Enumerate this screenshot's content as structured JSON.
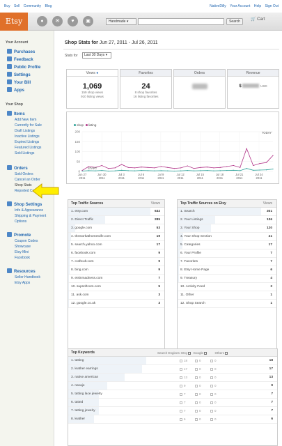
{
  "top": {
    "left_links": [
      "Buy",
      "Sell",
      "Community",
      "Blog"
    ],
    "right_links": [
      "NativeDilly",
      "Your Account",
      "Help",
      "Sign Out"
    ]
  },
  "nav": {
    "logo": "Etsy",
    "icons": [
      "circle-icon",
      "mail-icon",
      "heart-icon",
      "bag-icon"
    ],
    "search_category": "Handmade",
    "search_placeholder": "",
    "search_button": "Search",
    "cart_label": "Cart"
  },
  "sidebar": {
    "account_heading": "Your Account",
    "account_items": [
      "Purchases",
      "Feedback",
      "Public Profile",
      "Settings",
      "Your Bill",
      "Apps"
    ],
    "shop_heading": "Your Shop",
    "items_title": "Items",
    "items_sub": [
      "Add New Item",
      "Currently for Sale",
      "Draft Listings",
      "Inactive Listings",
      "Expired Listings",
      "Featured Listings",
      "Sold Listings"
    ],
    "orders_title": "Orders",
    "orders_sub": [
      "Sold Orders",
      "Cancel an Order",
      "Shop Stats",
      "Reported Cases"
    ],
    "settings_title": "Shop Settings",
    "settings_sub": [
      "Info & Appearance",
      "Shipping & Payment",
      "Options"
    ],
    "promote_title": "Promote",
    "promote_sub": [
      "Coupon Codes",
      "Showcase",
      "Etsy Mini",
      "Facebook"
    ],
    "resources_title": "Resources",
    "resources_sub": [
      "Seller Handbook",
      "Etsy Apps"
    ]
  },
  "main": {
    "title_prefix": "Shop Stats for",
    "title_range": "Jun 27, 2011 - Jul 26, 2011",
    "stats_for_label": "Stats for",
    "range_value": "Last 30 Days",
    "cards": {
      "views": {
        "label": "Views",
        "value": "1,069",
        "line1": "159 shop views",
        "line2": "910 listing views"
      },
      "favorites": {
        "label": "Favorites",
        "value": "24",
        "line1": "8 shop favorites",
        "line2": "16 listing favorites"
      },
      "orders": {
        "label": "Orders"
      },
      "revenue": {
        "label": "Revenue",
        "prefix": "$",
        "suffix": "USD"
      }
    }
  },
  "chart_data": {
    "type": "line",
    "legend": [
      "shop",
      "listing"
    ],
    "y_ticks": [
      "0",
      "50",
      "100",
      "150",
      "200"
    ],
    "ylim": [
      0,
      200
    ],
    "x_tick_labels": [
      [
        "Jun 27",
        "2011"
      ],
      [
        "Jun 30",
        "2011"
      ],
      [
        "Jul 3",
        "2011"
      ],
      [
        "Jul 6",
        "2011"
      ],
      [
        "Jul 9",
        "2011"
      ],
      [
        "Jul 12",
        "2011"
      ],
      [
        "Jul 15",
        "2011"
      ],
      [
        "Jul 18",
        "2011"
      ],
      [
        "Jul 21",
        "2011"
      ],
      [
        "Jul 24",
        "2011"
      ]
    ],
    "annotations": [
      "TODAY",
      "START"
    ],
    "series": [
      {
        "name": "listing",
        "color": "#b3378a",
        "values": [
          5,
          25,
          20,
          30,
          15,
          18,
          35,
          20,
          18,
          22,
          20,
          18,
          25,
          20,
          15,
          18,
          28,
          15,
          20,
          22,
          18,
          20,
          25,
          30,
          20,
          115,
          30,
          40,
          45,
          80
        ]
      },
      {
        "name": "shop",
        "color": "#2aa198",
        "values": [
          2,
          4,
          3,
          5,
          2,
          3,
          6,
          4,
          3,
          5,
          4,
          3,
          4,
          3,
          2,
          3,
          5,
          3,
          4,
          5,
          3,
          4,
          5,
          6,
          4,
          15,
          6,
          7,
          8,
          12
        ]
      }
    ]
  },
  "traffic": {
    "title": "Top Traffic Sources",
    "col": "Views",
    "rows": [
      {
        "name": "1. etsy.com",
        "value": "632"
      },
      {
        "name": "2. Direct Traffic",
        "value": "285"
      },
      {
        "name": "3. google.com",
        "value": "53"
      },
      {
        "name": "4. theworkathomewife.com",
        "value": "19"
      },
      {
        "name": "5. search.yahoo.com",
        "value": "17"
      },
      {
        "name": "6. facebook.com",
        "value": "9"
      },
      {
        "name": "7. craftcult.com",
        "value": "9"
      },
      {
        "name": "8. bing.com",
        "value": "9"
      },
      {
        "name": "9. etsinmadness.com",
        "value": "7"
      },
      {
        "name": "10. supsoftcom.com",
        "value": "5"
      },
      {
        "name": "11. ask.com",
        "value": "3"
      },
      {
        "name": "12. google.co.uk",
        "value": "3"
      }
    ]
  },
  "etsy_traffic": {
    "title": "Top Traffic Sources on Etsy",
    "col": "Views",
    "rows": [
      {
        "name": "1. Search",
        "value": "301"
      },
      {
        "name": "2. Your Listings",
        "value": "136"
      },
      {
        "name": "3. Your Shop",
        "value": "120"
      },
      {
        "name": "4. Your Shop Section",
        "value": "21"
      },
      {
        "name": "5. Categories",
        "value": "17"
      },
      {
        "name": "6. Your Profile",
        "value": "7"
      },
      {
        "name": "7. Favorites",
        "value": "7"
      },
      {
        "name": "8. Etsy Home Page",
        "value": "6"
      },
      {
        "name": "9. Treasury",
        "value": "4"
      },
      {
        "name": "10. Activity Feed",
        "value": "3"
      },
      {
        "name": "11. Other",
        "value": "1"
      },
      {
        "name": "12. Shop Search",
        "value": "1"
      }
    ]
  },
  "keywords": {
    "title": "Top Keywords",
    "engines_label": "Search Engines:",
    "engines": [
      "Etsy",
      "Google",
      "Others"
    ],
    "rows": [
      {
        "name": "1. tatting",
        "value": "18",
        "c1": "18",
        "c2": "0",
        "c3": "0"
      },
      {
        "name": "2. leather earrings",
        "value": "17",
        "c1": "17",
        "c2": "0",
        "c3": "0"
      },
      {
        "name": "3. native american",
        "value": "13",
        "c1": "13",
        "c2": "0",
        "c3": "0"
      },
      {
        "name": "4. navajo",
        "value": "9",
        "c1": "9",
        "c2": "0",
        "c3": "0"
      },
      {
        "name": "5. tatting lace jewelry",
        "value": "7",
        "c1": "7",
        "c2": "0",
        "c3": "0"
      },
      {
        "name": "6. tatted",
        "value": "7",
        "c1": "7",
        "c2": "0",
        "c3": "0"
      },
      {
        "name": "7. tatting jewelry",
        "value": "7",
        "c1": "7",
        "c2": "0",
        "c3": "0"
      },
      {
        "name": "8. leather",
        "value": "6",
        "c1": "6",
        "c2": "0",
        "c3": "0"
      }
    ]
  }
}
